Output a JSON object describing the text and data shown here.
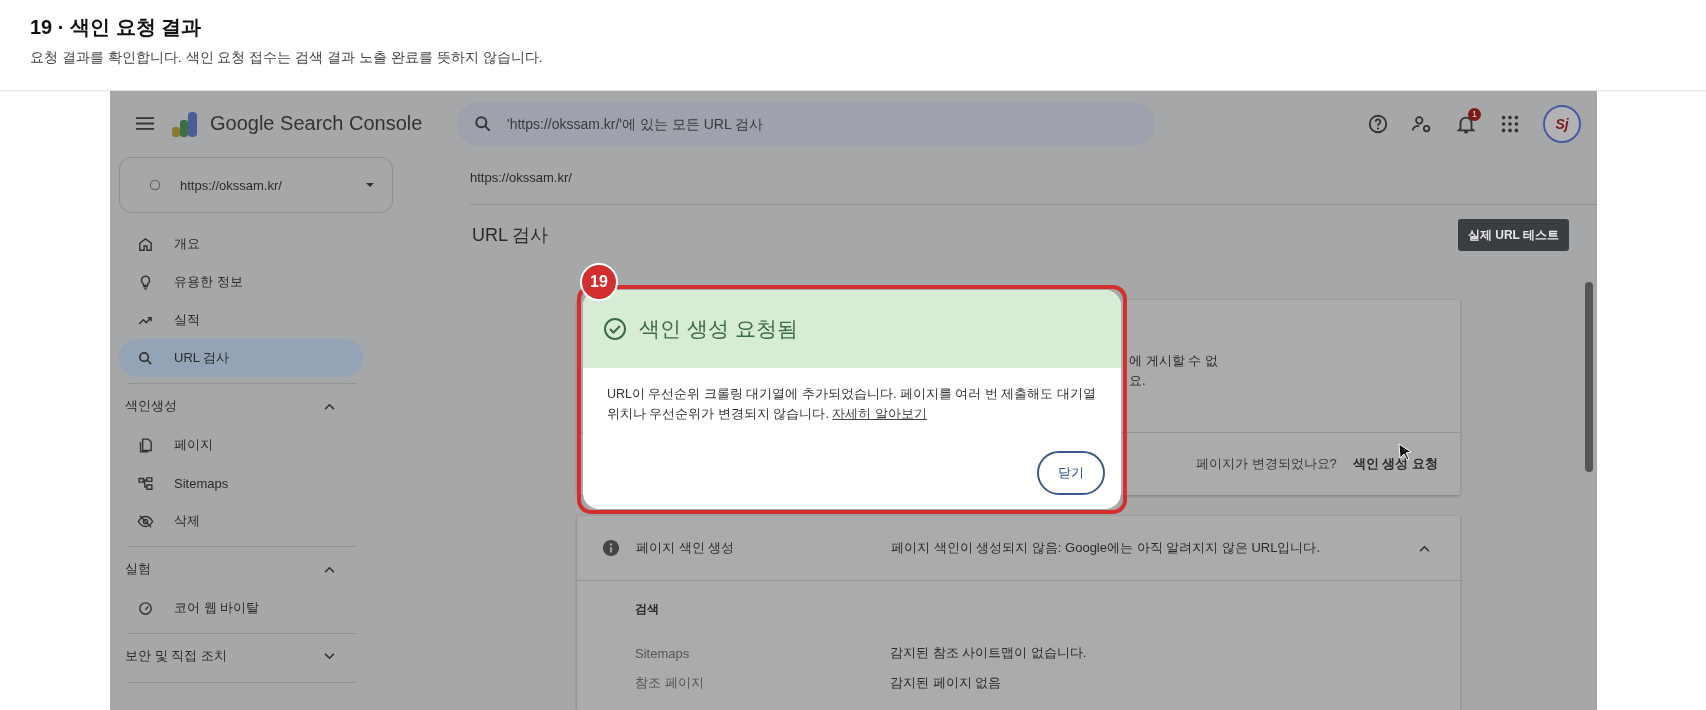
{
  "header": {
    "title": "19 · 색인 요청 결과",
    "subtitle": "요청 결과를 확인합니다. 색인 요청 접수는 검색 결과 노출 완료를 뜻하지 않습니다."
  },
  "app_bar": {
    "product": "Google Search Console",
    "search_placeholder": "'https://okssam.kr/'에 있는 모든 URL 검사",
    "notification_count": "1",
    "avatar_text": "Sj"
  },
  "property": "https://okssam.kr/",
  "nav": [
    {
      "label": "개요",
      "selected": false
    },
    {
      "label": "유용한 정보",
      "selected": false
    },
    {
      "label": "실적",
      "selected": false
    },
    {
      "label": "URL 검사",
      "selected": true
    }
  ],
  "sections": [
    {
      "title": "색인생성",
      "expanded": true,
      "items": [
        {
          "label": "페이지",
          "selected": false
        },
        {
          "label": "Sitemaps",
          "selected": false
        },
        {
          "label": "삭제",
          "selected": false
        }
      ]
    },
    {
      "title": "실험",
      "expanded": true,
      "items": [
        {
          "label": "코어 웹 바이탈",
          "selected": false
        }
      ]
    },
    {
      "title": "보안 및 직접 조치",
      "expanded": false
    }
  ],
  "breadcrumb": "https://okssam.kr/",
  "page_title": "URL 검사",
  "test_button": "실제 URL 테스트",
  "status_card": {
    "text_lines": [
      "에 게시할 수 없",
      "요."
    ],
    "question": "페이지가 변경되었나요?",
    "action": "색인 생성 요청"
  },
  "index_card": {
    "label": "페이지 색인 생성",
    "value": "페이지 색인이 생성되지 않음: Google에는 아직 알려지지 않은 URL입니다.",
    "expanded": true,
    "section": "검색",
    "rows": [
      {
        "label": "Sitemaps",
        "value": "감지된 참조 사이트맵이 없습니다."
      },
      {
        "label": "참조 페이지",
        "value": "감지된 페이지 없음"
      }
    ]
  },
  "dialog": {
    "title": "색인 생성 요청됨",
    "body": "URL이 우선순위 크롤링 대기열에 추가되었습니다. 페이지를 여러 번 제출해도 대기열 위치나 우선순위가 변경되지 않습니다.",
    "link": "자세히 알아보기",
    "close": "닫기"
  },
  "step_badge": "19"
}
